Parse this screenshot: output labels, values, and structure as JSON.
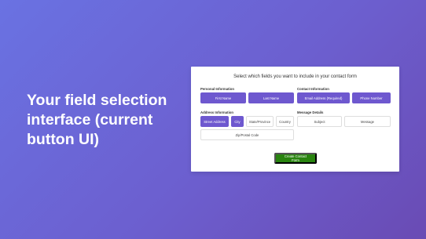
{
  "headline": {
    "line1": "Your field selection",
    "line2": "interface (current",
    "line3": "button UI)"
  },
  "panel": {
    "title": "Select which fields you want to include in your contact form",
    "personal": {
      "label": "Personal Information",
      "fields": [
        {
          "label": "First Name",
          "selected": true
        },
        {
          "label": "Last Name",
          "selected": true
        }
      ]
    },
    "contact": {
      "label": "Contact Information",
      "fields": [
        {
          "label": "Email Address (Required)",
          "selected": true
        },
        {
          "label": "Phone Number",
          "selected": true
        }
      ]
    },
    "address": {
      "label": "Address Information",
      "fields": [
        {
          "label": "Street Address",
          "selected": true
        },
        {
          "label": "City",
          "selected": true
        },
        {
          "label": "State/Province",
          "selected": false
        },
        {
          "label": "Country",
          "selected": false
        },
        {
          "label": "Zip/Postal Code",
          "selected": false
        }
      ]
    },
    "message": {
      "label": "Message Details",
      "fields": [
        {
          "label": "Subject",
          "selected": false
        },
        {
          "label": "Message",
          "selected": false
        }
      ]
    },
    "create_button": "Create Contact Form"
  },
  "colors": {
    "selected": "#6e58cf",
    "create": "#29840f",
    "background_start": "#6a72e2",
    "background_end": "#6a4bb4"
  }
}
